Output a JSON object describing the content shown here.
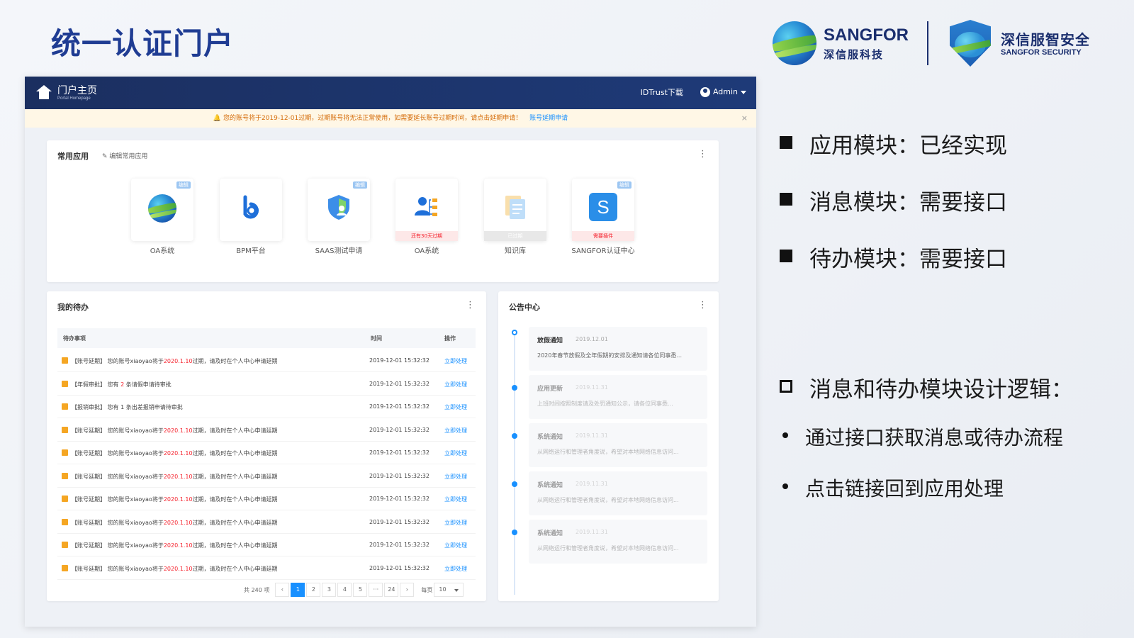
{
  "slide": {
    "title": "统一认证门户"
  },
  "logos": {
    "sangfor_en": "SANGFOR",
    "sangfor_cn": "深信服科技",
    "security_cn": "深信服智安全",
    "security_en": "SANGFOR SECURITY"
  },
  "portal": {
    "topbar": {
      "title": "门户主页",
      "subtitle": "Portal Homepage",
      "download": "IDTrust下载",
      "user": "Admin"
    },
    "notice": {
      "text": "您的账号将于2019-12-01过期，过期账号将无法正常使用，如需要延长账号过期时间，请点击延期申请！",
      "link": "账号延期申请",
      "close": "×"
    },
    "apps": {
      "title": "常用应用",
      "edit": "编辑常用应用",
      "menu": "⋮",
      "items": [
        {
          "label": "OA系统",
          "badge": "编辑",
          "status": ""
        },
        {
          "label": "BPM平台",
          "badge": "",
          "status": ""
        },
        {
          "label": "SAAS测试申请",
          "badge": "编辑",
          "status": ""
        },
        {
          "label": "OA系统",
          "badge": "",
          "status": "还有30天过期"
        },
        {
          "label": "知识库",
          "badge": "",
          "status": "已过期"
        },
        {
          "label": "SANGFOR认证中心",
          "badge": "编辑",
          "status": "需要插件"
        }
      ]
    },
    "todo": {
      "title": "我的待办",
      "menu": "⋮",
      "headers": {
        "item": "待办事项",
        "time": "时间",
        "action": "操作"
      },
      "rows": [
        {
          "prefix": "【账号延期】 您的账号xiaoyao将于",
          "highlight": "2020.1.10",
          "suffix": "过期，请及时在个人中心申请延期",
          "time": "2019-12-01  15:32:32",
          "action": "立即处理"
        },
        {
          "prefix": "【年假审批】 您有 ",
          "highlight": "2",
          "suffix": " 条请假申请待审批",
          "time": "2019-12-01  15:32:32",
          "action": "立即处理"
        },
        {
          "prefix": "【报销审批】 您有 1 条出差报销申请待审批",
          "highlight": "",
          "suffix": "",
          "time": "2019-12-01  15:32:32",
          "action": "立即处理"
        },
        {
          "prefix": "【账号延期】 您的账号xiaoyao将于",
          "highlight": "2020.1.10",
          "suffix": "过期，请及时在个人中心申请延期",
          "time": "2019-12-01  15:32:32",
          "action": "立即处理"
        },
        {
          "prefix": "【账号延期】 您的账号xiaoyao将于",
          "highlight": "2020.1.10",
          "suffix": "过期，请及时在个人中心申请延期",
          "time": "2019-12-01  15:32:32",
          "action": "立即处理"
        },
        {
          "prefix": "【账号延期】 您的账号xiaoyao将于",
          "highlight": "2020.1.10",
          "suffix": "过期，请及时在个人中心申请延期",
          "time": "2019-12-01  15:32:32",
          "action": "立即处理"
        },
        {
          "prefix": "【账号延期】 您的账号xiaoyao将于",
          "highlight": "2020.1.10",
          "suffix": "过期，请及时在个人中心申请延期",
          "time": "2019-12-01  15:32:32",
          "action": "立即处理"
        },
        {
          "prefix": "【账号延期】 您的账号xiaoyao将于",
          "highlight": "2020.1.10",
          "suffix": "过期，请及时在个人中心申请延期",
          "time": "2019-12-01  15:32:32",
          "action": "立即处理"
        },
        {
          "prefix": "【账号延期】 您的账号xiaoyao将于",
          "highlight": "2020.1.10",
          "suffix": "过期，请及时在个人中心申请延期",
          "time": "2019-12-01  15:32:32",
          "action": "立即处理"
        },
        {
          "prefix": "【账号延期】 您的账号xiaoyao将于",
          "highlight": "2020.1.10",
          "suffix": "过期，请及时在个人中心申请延期",
          "time": "2019-12-01  15:32:32",
          "action": "立即处理"
        }
      ],
      "pager": {
        "total": "共 240 项",
        "prev": "‹",
        "pages": [
          "1",
          "2",
          "3",
          "4",
          "5",
          "···",
          "24"
        ],
        "next": "›",
        "per_label": "每页",
        "per_value": "10"
      }
    },
    "announcements": {
      "title": "公告中心",
      "menu": "⋮",
      "items": [
        {
          "title": "放假通知",
          "date": "2019.12.01",
          "body": "2020年春节放假及全年假期的安排及通知请各位同事悉..."
        },
        {
          "title": "应用更新",
          "date": "2019.11.31",
          "body": "上班时间按照制度请及处罚通知公示，请各位同事悉..."
        },
        {
          "title": "系统通知",
          "date": "2019.11.31",
          "body": "从网络运行和管理者角度说，希望对本地网络信息访问..."
        },
        {
          "title": "系统通知",
          "date": "2019.11.31",
          "body": "从网络运行和管理者角度说，希望对本地网络信息访问..."
        },
        {
          "title": "系统通知",
          "date": "2019.11.31",
          "body": "从网络运行和管理者角度说，希望对本地网络信息访问..."
        }
      ]
    }
  },
  "bullets": {
    "items": [
      "应用模块：已经实现",
      "消息模块：需要接口",
      "待办模块：需要接口"
    ],
    "design_title": "消息和待办模块设计逻辑：",
    "sub_items": [
      "通过接口获取消息或待办流程",
      "点击链接回到应用处理"
    ]
  },
  "colors": {
    "title_blue": "#1f3c93",
    "topbar": "#1e3a78",
    "accent": "#1890ff",
    "warning": "#f5a623",
    "danger": "#f5222d"
  }
}
